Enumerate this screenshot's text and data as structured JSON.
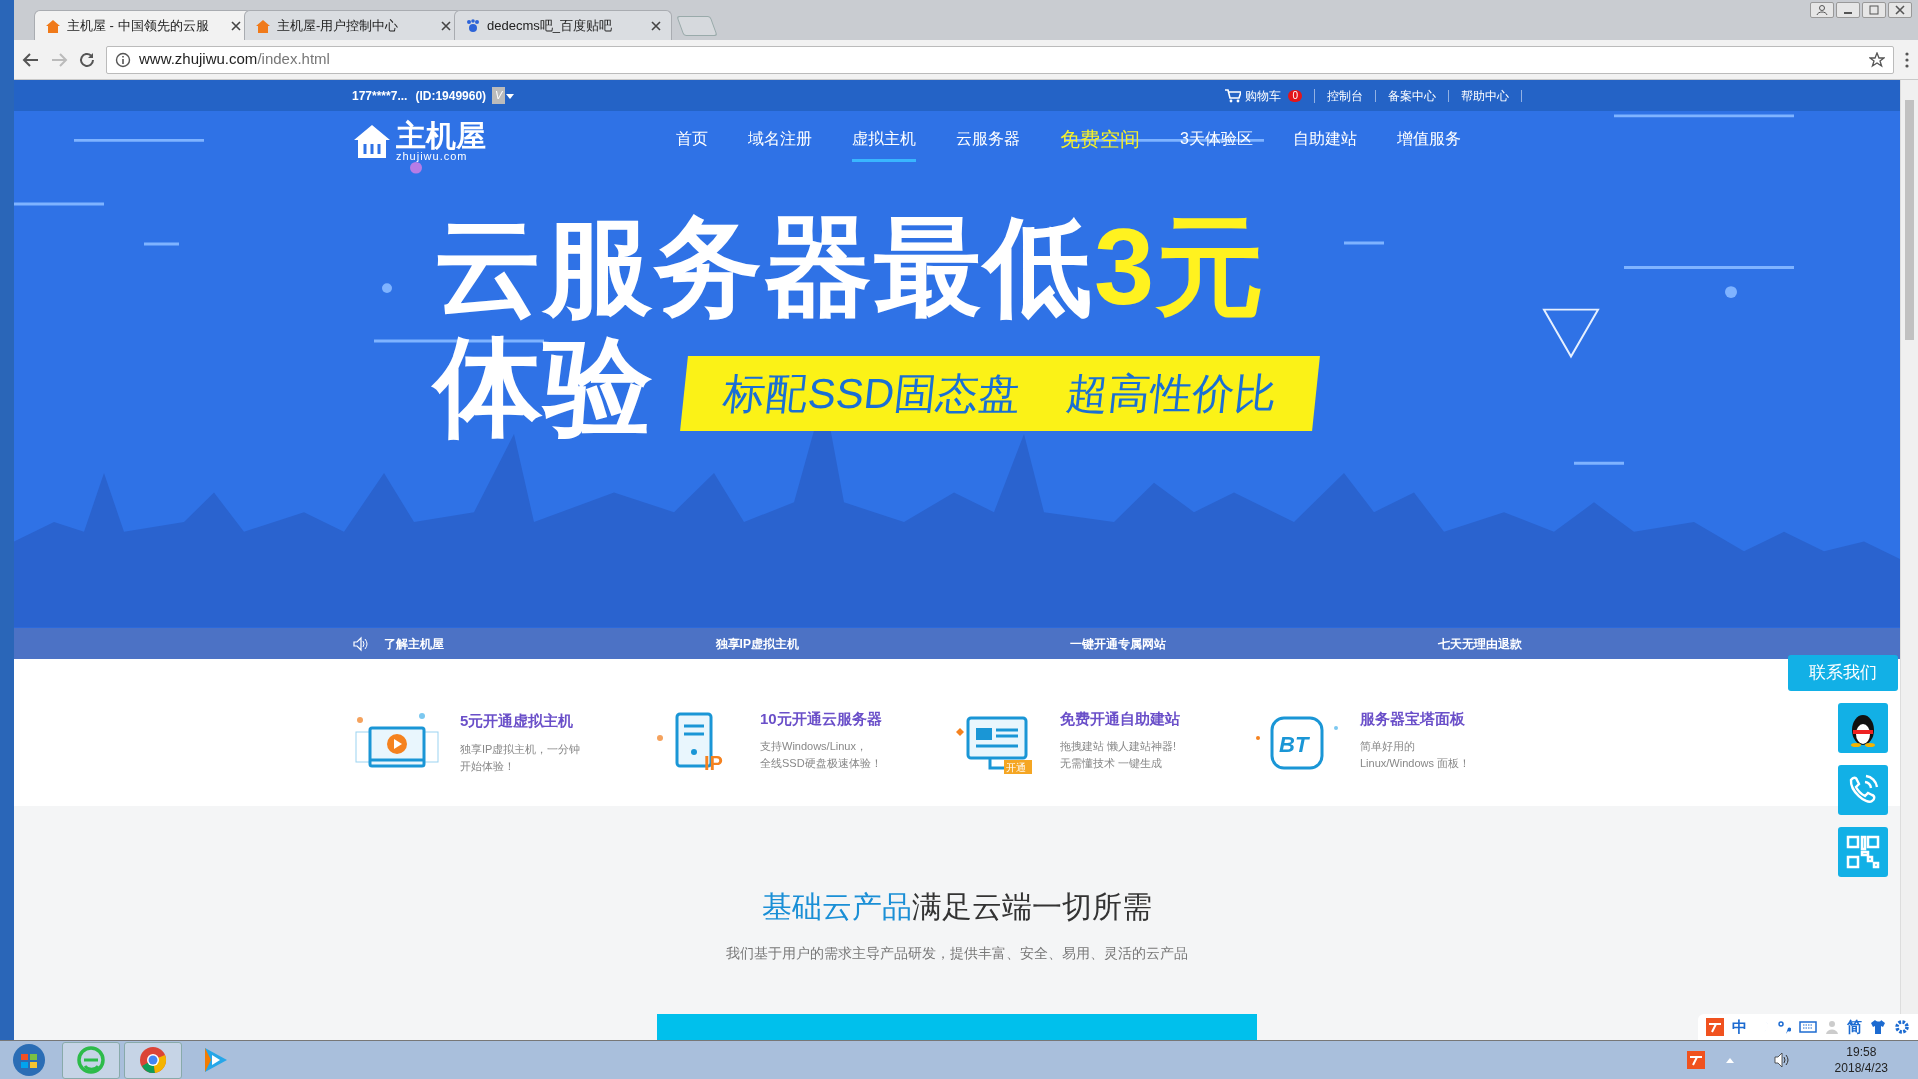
{
  "browser": {
    "tabs": [
      {
        "title": "主机屋 - 中国领先的云服",
        "selected": true,
        "kind": "house"
      },
      {
        "title": "主机屋-用户控制中心",
        "selected": false,
        "kind": "house"
      },
      {
        "title": "dedecms吧_百度贴吧",
        "selected": false,
        "kind": "paw"
      }
    ],
    "address": {
      "domain": "www.zhujiwu.com",
      "path": "/index.html"
    }
  },
  "topbar": {
    "user": "177****7...",
    "user_id": "(ID:1949960)",
    "badge": "V",
    "links": [
      {
        "label": "购物车",
        "count": "0"
      },
      {
        "label": "控制台"
      },
      {
        "label": "备案中心"
      },
      {
        "label": "帮助中心"
      }
    ]
  },
  "logo": {
    "name": "主机屋",
    "sub": "zhujiwu.com"
  },
  "nav": [
    {
      "label": "首页",
      "selected": false,
      "kind": "link"
    },
    {
      "label": "域名注册",
      "selected": false,
      "kind": "link"
    },
    {
      "label": "虚拟主机",
      "selected": true,
      "kind": "link"
    },
    {
      "label": "云服务器",
      "selected": false,
      "kind": "link"
    },
    {
      "label": "免费空间",
      "selected": false,
      "kind": "promo"
    },
    {
      "label": "3天体验区",
      "selected": false,
      "kind": "link"
    },
    {
      "label": "自助建站",
      "selected": false,
      "kind": "link"
    },
    {
      "label": "增值服务",
      "selected": false,
      "kind": "link"
    }
  ],
  "banner": {
    "headline": "云服务器最低",
    "accent": "3元",
    "headline_2": "体验",
    "ribbon": [
      "标配SSD固态盘",
      "超高性价比"
    ]
  },
  "banner_strip": [
    "了解主机屋",
    "独享IP虚拟主机",
    "一键开通专属网站",
    "七天无理由退款"
  ],
  "features": [
    {
      "title": "5元开通虚拟主机",
      "lines": [
        "独享IP虚拟主机，一分钟",
        "开始体验！"
      ],
      "kind": "play"
    },
    {
      "title": "10元开通云服务器",
      "lines": [
        "支持Windows/Linux，",
        "全线SSD硬盘极速体验！"
      ],
      "kind": "server",
      "icon_label": "IP"
    },
    {
      "title": "免费开通自助建站",
      "lines": [
        "拖拽建站 懒人建站神器!",
        "无需懂技术 一键生成"
      ],
      "kind": "monitor",
      "icon_label": "开通"
    },
    {
      "title": "服务器宝塔面板",
      "lines": [
        "简单好用的",
        "Linux/Windows 面板！"
      ],
      "kind": "bt",
      "icon_label": "BT"
    }
  ],
  "section": {
    "title_accent": "基础云产品",
    "title_rest": "满足云端一切所需",
    "subtitle": "我们基于用户的需求主导产品研发，提供丰富、安全、易用、灵活的云产品"
  },
  "contact": {
    "label": "联系我们"
  },
  "ime": {
    "mode": "中",
    "script": "简"
  },
  "taskbar": {
    "time": "19:58",
    "date": "2018/4/23"
  }
}
